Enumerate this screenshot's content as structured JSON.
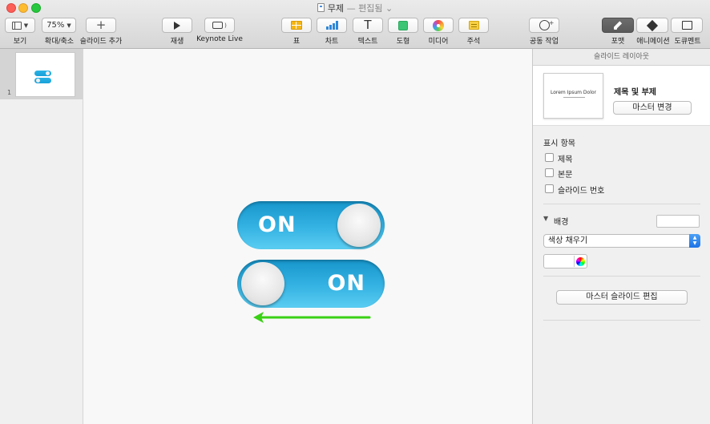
{
  "window": {
    "title": "무제",
    "status": "— 편집됨"
  },
  "toolbar": {
    "view": {
      "label": "보기",
      "icon": "sidebar-view-icon"
    },
    "zoom": {
      "label": "확대/축소",
      "value": "75%"
    },
    "add_slide": {
      "label": "슬라이드 추가"
    },
    "play": {
      "label": "재생"
    },
    "keynote_live": {
      "label": "Keynote Live"
    },
    "table": {
      "label": "표"
    },
    "chart": {
      "label": "차트"
    },
    "text": {
      "label": "텍스트",
      "glyph": "T"
    },
    "shape": {
      "label": "도형"
    },
    "media": {
      "label": "미디어"
    },
    "comment": {
      "label": "주석"
    },
    "collaborate": {
      "label": "공동 작업"
    },
    "format": {
      "label": "포맷",
      "active": true
    },
    "animate": {
      "label": "애니메이션"
    },
    "document": {
      "label": "도큐멘트"
    }
  },
  "navigator": {
    "slides": [
      {
        "number": "1"
      }
    ]
  },
  "slide": {
    "toggles": [
      {
        "label": "ON",
        "knob": "right"
      },
      {
        "label": "ON",
        "knob": "left"
      }
    ],
    "arrow": {
      "direction": "left",
      "color": "#3ad115"
    }
  },
  "inspector": {
    "header": "슬라이드 레이아웃",
    "master": {
      "thumb_text": "Lorem Ipsum Dolor",
      "name": "제목 및 부제",
      "change_button": "마스터 변경"
    },
    "appearance": {
      "label": "표시 항목",
      "items": [
        "제목",
        "본문",
        "슬라이드 번호"
      ]
    },
    "background": {
      "label": "배경",
      "fill_type": "색상 채우기",
      "color": "#ffffff"
    },
    "edit_master_button": "마스터 슬라이드 편집"
  }
}
